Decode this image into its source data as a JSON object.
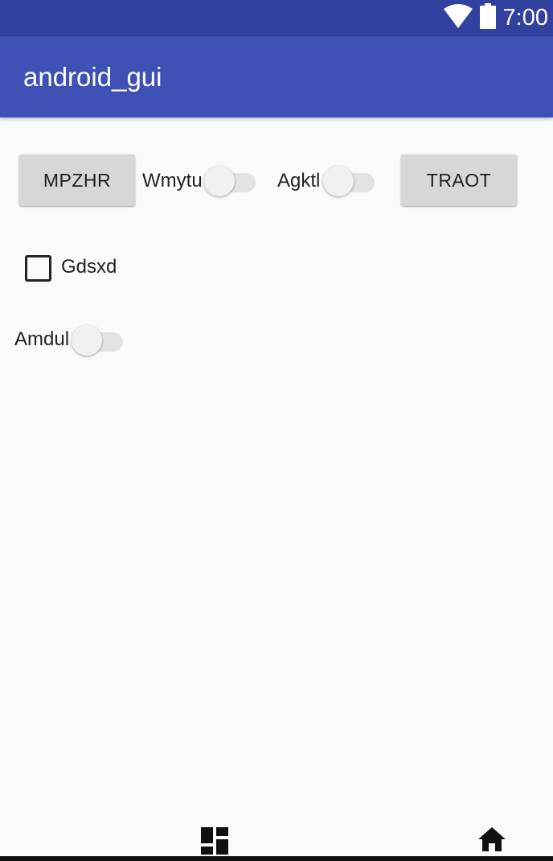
{
  "status_bar": {
    "time": "7:00",
    "icons": [
      "wifi-icon",
      "battery-icon"
    ]
  },
  "app_bar": {
    "title": "android_gui"
  },
  "row1": {
    "button_left": "MPZHR",
    "switch1_label": "Wmytu",
    "switch2_label": "Agktl",
    "button_right": "TRAOT"
  },
  "checkbox": {
    "label": "Gdsxd",
    "checked": false
  },
  "switch3": {
    "label": "Amdul"
  },
  "nav_bar": {
    "icons": [
      "dashboard-icon",
      "home-icon"
    ]
  },
  "colors": {
    "status_bar": "#3240a0",
    "app_bar": "#3f51b5",
    "background": "#fafafa",
    "button": "#d6d7d7"
  }
}
